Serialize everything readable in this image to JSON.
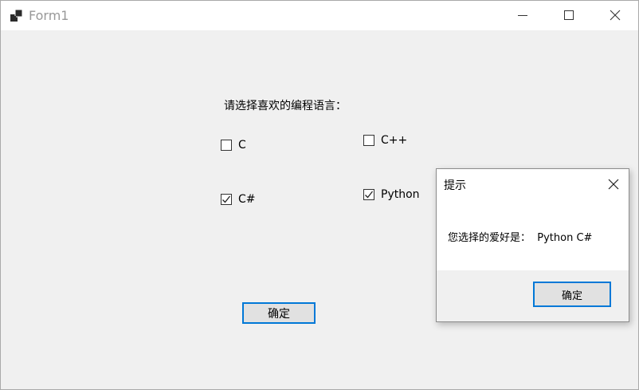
{
  "window": {
    "title": "Form1",
    "icons": {
      "app": "app-icon",
      "minimize": "minimize-icon",
      "maximize": "maximize-icon",
      "close": "close-icon"
    }
  },
  "form": {
    "prompt": "请选择喜欢的编程语言：",
    "checkboxes": [
      {
        "label": "C",
        "checked": false
      },
      {
        "label": "C++",
        "checked": false
      },
      {
        "label": "C#",
        "checked": true
      },
      {
        "label": "Python",
        "checked": true
      }
    ],
    "ok_button": "确定"
  },
  "dialog": {
    "title": "提示",
    "message": "您选择的爱好是：  Python C#",
    "ok_button": "确定",
    "close_icon": "close-icon"
  },
  "colors": {
    "accent": "#0078d7",
    "client_bg": "#f0f0f0",
    "button_bg": "#e1e1e1"
  }
}
